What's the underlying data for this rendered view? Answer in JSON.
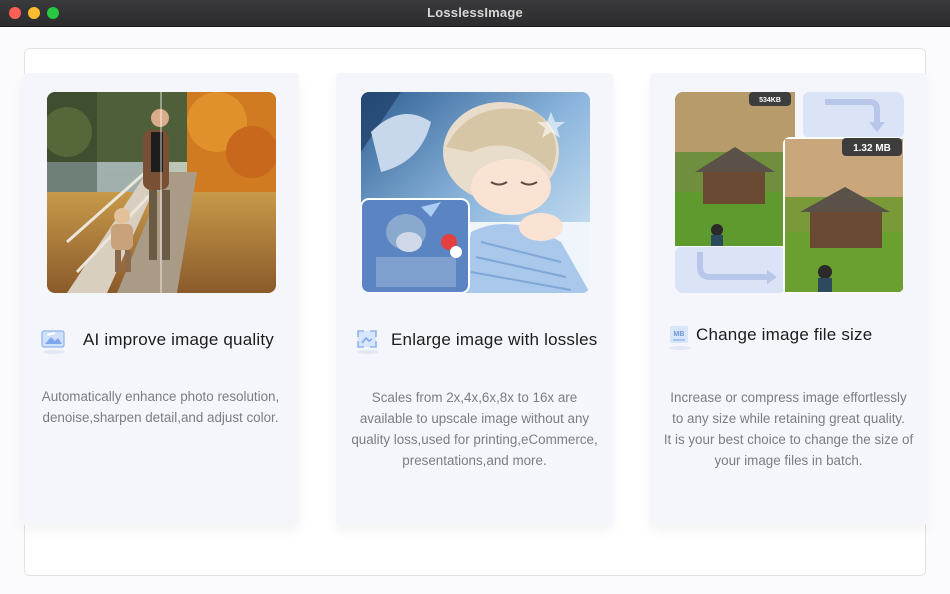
{
  "window": {
    "title": "LosslessImage"
  },
  "features": [
    {
      "icon": "ai-quality-icon",
      "title": "AI improve image quality",
      "desc": [
        "Automatically enhance photo resolution,",
        "denoise,sharpen detail,and adjust color."
      ]
    },
    {
      "icon": "enlarge-image-icon",
      "title": "Enlarge image with lossles",
      "desc": [
        "Scales from 2x,4x,6x,8x to 16x are",
        "available to upscale image without any",
        "quality loss,used for printing,eCommerce,",
        "presentations,and more."
      ]
    },
    {
      "icon": "file-size-icon",
      "title": "Change image file size",
      "desc": [
        "Increase or compress image effortlessly",
        "to any size while retaining great quality.",
        "It is your best choice to change the size of",
        "your image files in batch."
      ],
      "badges": {
        "small": "534KB",
        "large": "1.32 MB"
      },
      "icon_label": "MB"
    }
  ]
}
